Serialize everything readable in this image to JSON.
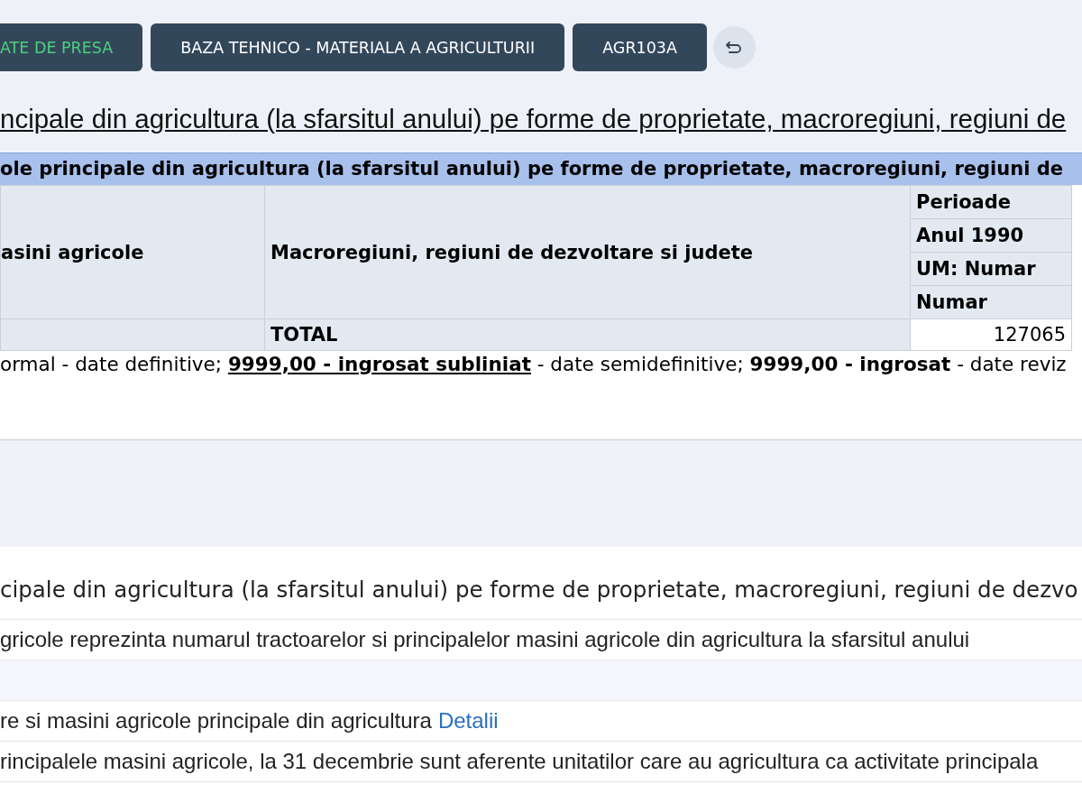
{
  "nav_buttons": [
    {
      "label": "ATE DE PRESA",
      "kind": "highlight"
    },
    {
      "label": "BAZA TEHNICO - MATERIALA A AGRICULTURII",
      "kind": "plain"
    },
    {
      "label": "AGR103A",
      "kind": "plain"
    }
  ],
  "title": "ncipale din agricultura (la sfarsitul anului) pe forme de proprietate, macroregiuni, regiuni de",
  "table": {
    "caption": "ole principale din agricultura (la sfarsitul anului) pe forme de proprietate, macroregiuni, regiuni de",
    "column_1": "asini agricole",
    "column_2": "Macroregiuni, regiuni de dezvoltare si judete",
    "period_header": "Perioade",
    "year": "Anul 1990",
    "unit": "UM: Numar",
    "measure": "Numar",
    "rows": [
      {
        "column_2": "TOTAL",
        "value": "127065"
      }
    ]
  },
  "legend": [
    {
      "text": "ormal - date definitive; ",
      "kind": "plain"
    },
    {
      "text": "9999,00 - ingrosat subliniat",
      "kind": "bold-underline"
    },
    {
      "text": " - date semidefinitive; ",
      "kind": "plain"
    },
    {
      "text": "9999,00 - ingrosat",
      "kind": "bold"
    },
    {
      "text": " - date reviz",
      "kind": "plain"
    }
  ],
  "details": {
    "heading": "cipale din agricultura (la sfarsitul anului) pe forme de proprietate, macroregiuni, regiuni de dezvo",
    "rows": [
      {
        "text": "gricole reprezinta numarul tractoarelor si principalelor masini agricole din agricultura la sfarsitul anului",
        "kind": "text"
      },
      {
        "kind": "empty"
      },
      {
        "text": "re si masini agricole principale din agricultura",
        "link": "Detalii",
        "kind": "link"
      },
      {
        "text": "rincipalele masini agricole, la 31 decembrie sunt aferente unitatilor care au agricultura ca activitate principala",
        "kind": "text"
      }
    ]
  }
}
